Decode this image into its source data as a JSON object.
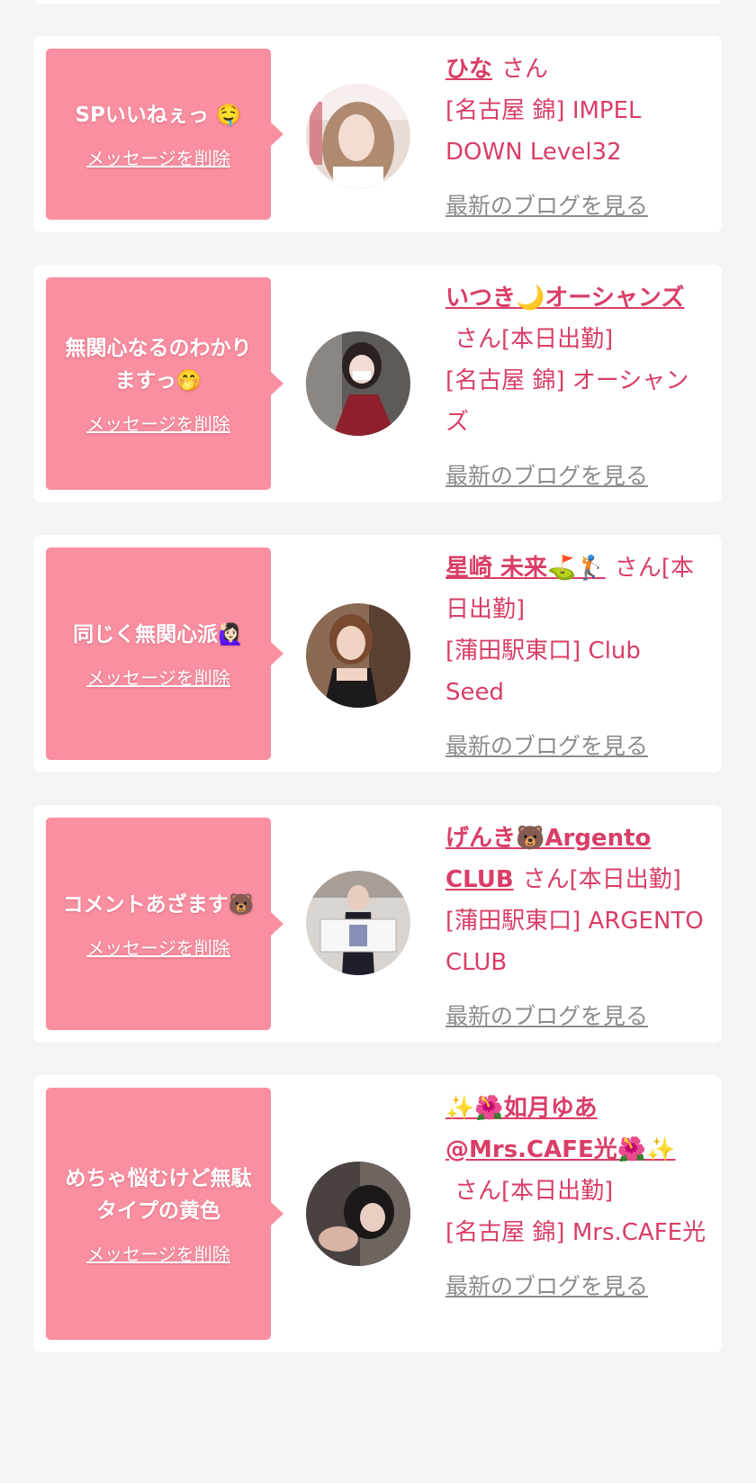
{
  "cards": [
    {
      "message": "SPいいねぇっ 🤤",
      "delete_label": "メッセージを削除",
      "name": "ひな",
      "suffix": "さん",
      "shop": "[名古屋 錦] IMPEL DOWN Level32",
      "blog_label": "最新のブログを見る"
    },
    {
      "message": "無関心なるのわかりますっ🤭",
      "delete_label": "メッセージを削除",
      "name": "いつき🌙オーシャンズ",
      "suffix": "さん[本日出勤]",
      "shop": "[名古屋 錦] オーシャンズ",
      "blog_label": "最新のブログを見る"
    },
    {
      "message": "同じく無関心派🙋🏻‍♀️",
      "delete_label": "メッセージを削除",
      "name": "星崎 未来⛳🏌️",
      "suffix": "さん[本日出勤]",
      "shop": "[蒲田駅東口] Club Seed",
      "blog_label": "最新のブログを見る"
    },
    {
      "message": "コメントあざます🐻",
      "delete_label": "メッセージを削除",
      "name": "げんき🐻Argento CLUB",
      "suffix": "さん[本日出勤]",
      "shop": "[蒲田駅東口] ARGENTO CLUB",
      "blog_label": "最新のブログを見る"
    },
    {
      "message": "めちゃ悩むけど無駄タイプの黄色",
      "delete_label": "メッセージを削除",
      "name": "✨🌺如月ゆあ@Mrs.CAFE光🌺✨",
      "suffix": "さん[本日出勤]",
      "shop": "[名古屋 錦] Mrs.CAFE光",
      "blog_label": "最新のブログを見る"
    }
  ]
}
